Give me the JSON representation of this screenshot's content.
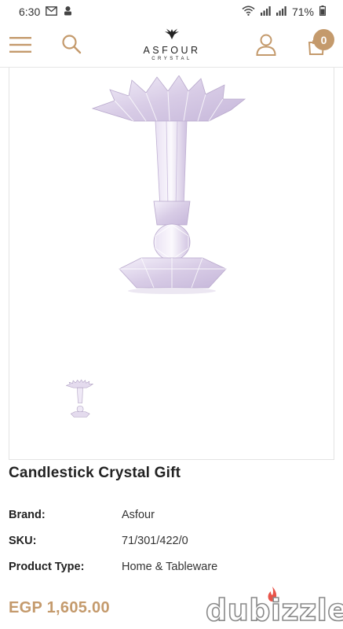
{
  "status_bar": {
    "time": "6:30",
    "battery": "71%",
    "left_icons": [
      "gmail-icon",
      "notification-icon"
    ],
    "right_icons": [
      "wifi-icon",
      "signal-icon",
      "signal-icon",
      "battery-icon"
    ]
  },
  "header": {
    "menu_icon": "hamburger-menu-icon",
    "search_icon": "search-icon",
    "logo": {
      "name": "ASFOUR",
      "sub": "CRYSTAL",
      "mark": "bird-logo-icon"
    },
    "account_icon": "user-icon",
    "cart_icon": "shopping-bag-icon",
    "cart_count": "0"
  },
  "product": {
    "title": "Candlestick Crystal Gift",
    "specs": [
      {
        "label": "Brand:",
        "value": "Asfour"
      },
      {
        "label": "SKU:",
        "value": "71/301/422/0"
      },
      {
        "label": "Product Type:",
        "value": "Home & Tableware"
      }
    ],
    "price": "EGP 1,605.00"
  },
  "watermark": {
    "text": "dubizzle"
  },
  "colors": {
    "accent": "#c49a6c",
    "crystal": "#ddd3ea",
    "border": "#e3e3e3"
  }
}
